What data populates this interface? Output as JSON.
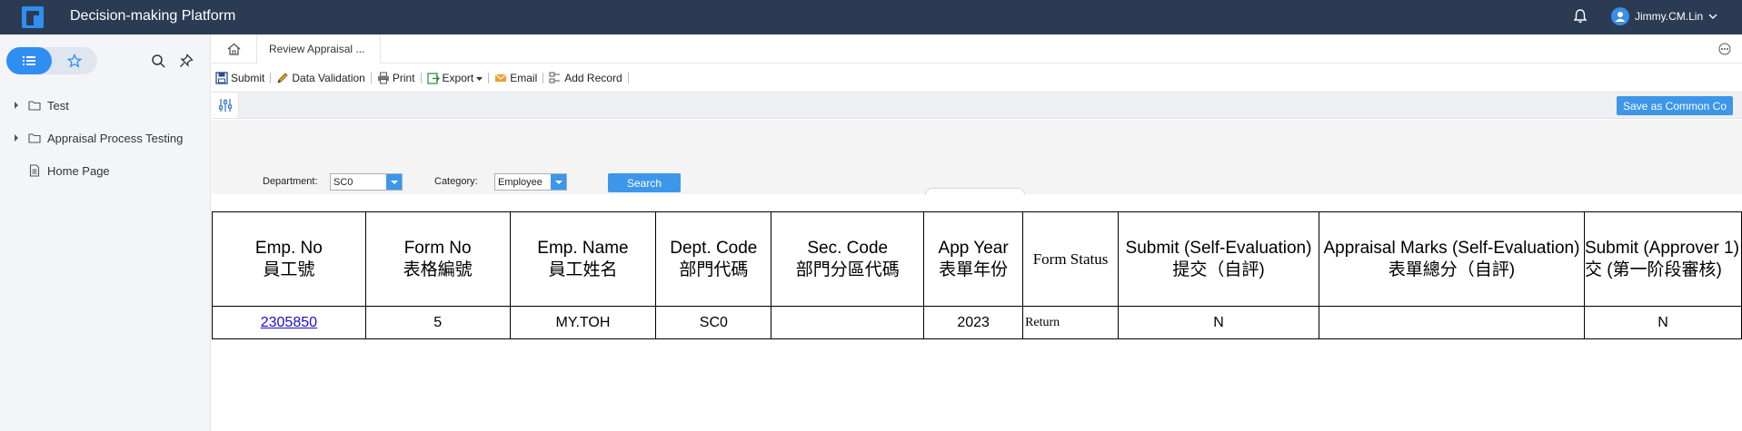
{
  "app": {
    "title": "Decision-making Platform",
    "user_name": "Jimmy.CM.Lin"
  },
  "sidebar": {
    "items": [
      {
        "label": "Test",
        "type": "folder",
        "expandable": true
      },
      {
        "label": "Appraisal Process Testing",
        "type": "folder",
        "expandable": true
      },
      {
        "label": "Home Page",
        "type": "page",
        "expandable": false
      }
    ]
  },
  "tabs": {
    "active_tab": "Review Appraisal ..."
  },
  "toolbar": {
    "submit": "Submit",
    "data_validation": "Data Validation",
    "print": "Print",
    "export": "Export",
    "email": "Email",
    "add_record": "Add Record"
  },
  "params": {
    "save_common": "Save as Common Co"
  },
  "filters": {
    "department_label": "Department:",
    "department_value": "SC0",
    "category_label": "Category:",
    "category_value": "Employee",
    "search_label": "Search"
  },
  "table": {
    "headers": [
      {
        "en": "Emp. No",
        "zh": "員工號"
      },
      {
        "en": "Form No",
        "zh": "表格編號"
      },
      {
        "en": "Emp. Name",
        "zh": "員工姓名"
      },
      {
        "en": "Dept. Code",
        "zh": "部門代碼"
      },
      {
        "en": "Sec. Code",
        "zh": "部門分區代碼"
      },
      {
        "en": "App Year",
        "zh": "表單年份"
      },
      {
        "en": "Form Status",
        "zh": ""
      },
      {
        "en": "Submit (Self-Evaluation)",
        "zh": "提交（自評)"
      },
      {
        "en": "Appraisal Marks (Self-Evaluation)",
        "zh": "表單總分（自評)"
      },
      {
        "en": "Submit (Approver 1)",
        "zh": "交 (第一阶段審核)"
      }
    ],
    "rows": [
      [
        "2305850",
        "5",
        "MY.TOH",
        "SC0",
        "",
        "2023",
        "Return",
        "N",
        "",
        "N"
      ]
    ]
  },
  "colors": {
    "topbar": "#2c3b54",
    "accent": "#3d96e9",
    "link": "#1a0dcc"
  }
}
